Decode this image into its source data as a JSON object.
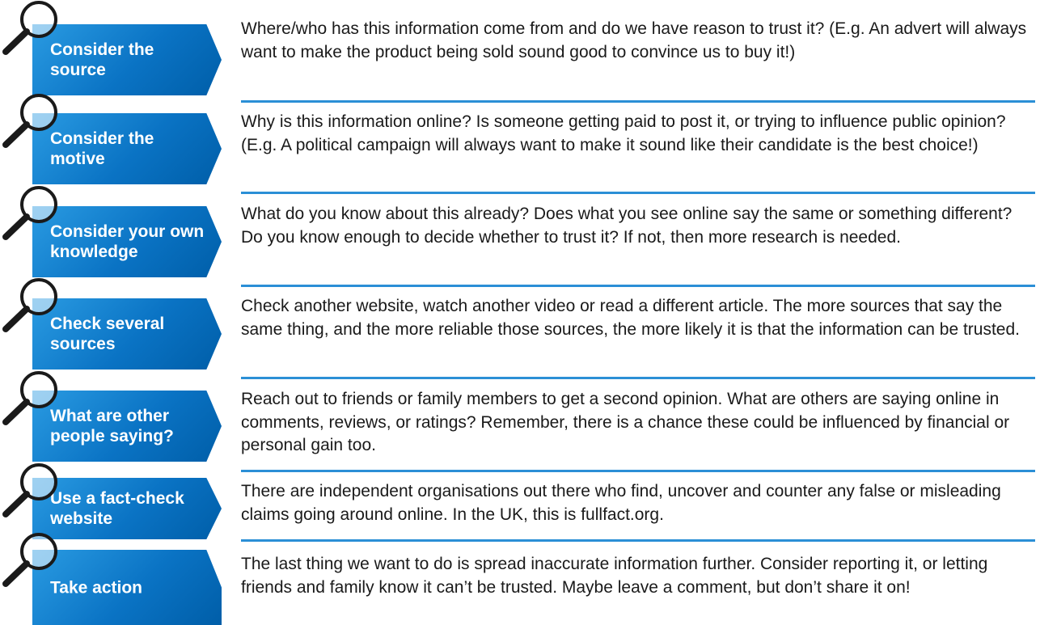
{
  "items": [
    {
      "label": "Consider the source",
      "description": "Where/who has this information come from and do we have reason to trust it? (E.g. An advert will always want to make the product being sold sound good to convince us to buy it!)",
      "icon": "magnifying-glass-icon"
    },
    {
      "label": "Consider the motive",
      "description": "Why is this information online? Is someone getting paid to post it, or trying to influence public opinion? (E.g. A political campaign will always want to make it sound like their candidate is the best choice!)",
      "icon": "magnifying-glass-icon"
    },
    {
      "label": "Consider your own knowledge",
      "description": "What do you know about this already? Does what you see online say the same or something different? Do you know enough to decide whether to trust it? If not, then more research is needed.",
      "icon": "magnifying-glass-icon"
    },
    {
      "label": "Check several sources",
      "description": "Check another website, watch another video or read a different article. The more sources that say the same thing, and the more reliable those sources, the more likely it is that the information can be trusted.",
      "icon": "magnifying-glass-icon"
    },
    {
      "label": "What are other people saying?",
      "description": "Reach out to friends or family members to get a second opinion. What are others are saying online in comments, reviews, or ratings? Remember, there is a chance these could be influenced by financial or personal gain too.",
      "icon": "magnifying-glass-icon"
    },
    {
      "label": "Use a fact-check website",
      "description": "There are independent organisations out there who find, uncover and counter any false or misleading claims going around online. In the UK, this is fullfact.org.",
      "icon": "magnifying-glass-icon"
    },
    {
      "label": "Take action",
      "description": "The last thing we want to do is spread inaccurate information further. Consider reporting it, or letting friends and family know it can’t be trusted. Maybe leave a comment, but don’t share it on!",
      "icon": "magnifying-glass-icon"
    }
  ],
  "colors": {
    "accent": "#0a73c4",
    "accent_light": "#2a9be2",
    "rule": "#2b8fd6",
    "text": "#1a1a1a"
  }
}
